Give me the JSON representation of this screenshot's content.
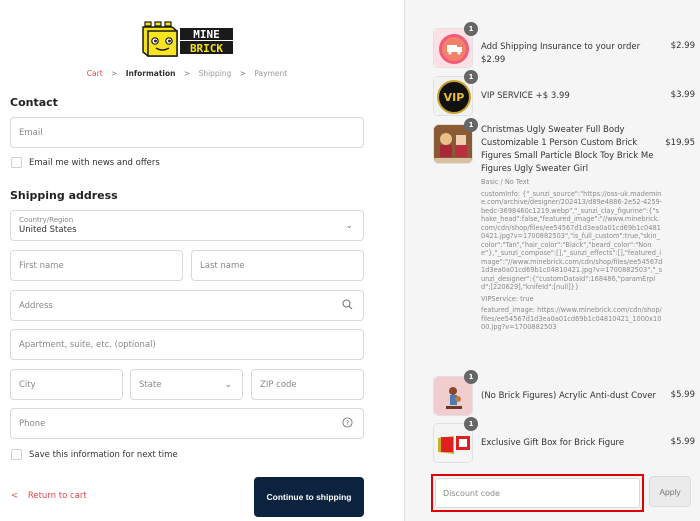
{
  "brand": {
    "name_top": "MINE",
    "name_bottom": "BRICK",
    "colors": {
      "yellow": "#f5e11b",
      "dark": "#1a1a1a",
      "accent": "#e5484d",
      "button": "#0c2340"
    }
  },
  "breadcrumb": [
    {
      "label": "Cart",
      "state": "link"
    },
    {
      "label": "Information",
      "state": "active"
    },
    {
      "label": "Shipping",
      "state": "inactive"
    },
    {
      "label": "Payment",
      "state": "inactive"
    }
  ],
  "breadcrumb_separator": ">",
  "contact": {
    "heading": "Contact",
    "email_placeholder": "Email",
    "newsletter_label": "Email me with news and offers",
    "newsletter_checked": false
  },
  "shipping": {
    "heading": "Shipping address",
    "country_label": "Country/Region",
    "country_value": "United States",
    "first_name_placeholder": "First name",
    "last_name_placeholder": "Last name",
    "address_placeholder": "Address",
    "apartment_placeholder": "Apartment, suite, etc. (optional)",
    "city_placeholder": "City",
    "state_placeholder": "State",
    "zip_placeholder": "ZIP code",
    "phone_placeholder": "Phone",
    "save_label": "Save this information for next time",
    "save_checked": false
  },
  "actions": {
    "return_label": "Return to cart",
    "continue_label": "Continue to shipping"
  },
  "order": {
    "items": [
      {
        "title": "Add Shipping Insurance to your order $2.99",
        "price": "$2.99",
        "qty": "1",
        "thumb": "shipping-insurance"
      },
      {
        "title": "VIP SERVICE +$ 3.99",
        "price": "$3.99",
        "qty": "1",
        "thumb": "vip"
      },
      {
        "title": "Christmas Ugly Sweater Full Body Customizable 1 Person Custom Brick Figures Small Particle Block Toy Brick Me Figures Ugly Sweater Girl",
        "price": "$19.95",
        "qty": "1",
        "thumb": "christmas-figure",
        "variant": "Basic / No Text",
        "custom_info": "customInfo: {\"_sunzi_source\":\"https://oss-uk.mademine.com/archive/designer/202413/d89e4886-2e52-4259-bedc-3698460c1219.webp\",\"_sunzi_clay_figurine\":{\"shake_head\":false,\"featured_image\":\"//www.minebrick.com/cdn/shop/files/ee54567d1d3ea0a01cd69b1c04810421.jpg?v=1700882503\",\"is_full_custom\":true,\"skin_color\":\"Tan\",\"hair_color\":\"Black\",\"beard_color\":\"None\"},\"_sunzi_compose\":[],\"_sunzi_effects\":[],\"featured_image\":\"//www.minebrick.com/cdn/shop/files/ee54567d1d3ea0a01cd69b1c04810421.jpg?v=1700882503\",\"_sunzi_designer\":{\"customDataId\":168486,\"paramErpId\":[220629],\"knifeId\":[null]}}",
        "vip_service": "VIPService: true",
        "featured_image": "featured_image: https://www.minebrick.com/cdn/shop/files/ee54567d1d3ea0a01cd69b1c04810421_1000x1000.jpg?v=1700882503"
      },
      {
        "title": "(No Brick Figures) Acrylic Anti-dust Cover",
        "price": "$5.99",
        "qty": "1",
        "thumb": "acrylic-cover"
      },
      {
        "title": "Exclusive Gift Box for Brick Figure",
        "price": "$5.99",
        "qty": "1",
        "thumb": "gift-box"
      }
    ],
    "discount_placeholder": "Discount code",
    "apply_label": "Apply"
  }
}
